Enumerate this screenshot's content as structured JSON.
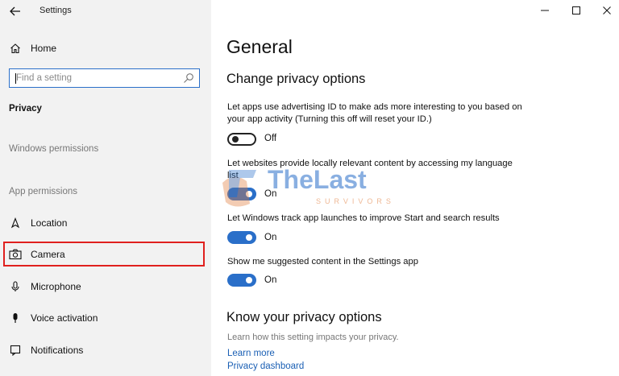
{
  "window": {
    "title": "Settings",
    "controls": {
      "minimize": "minimize",
      "maximize": "maximize",
      "close": "close"
    }
  },
  "sidebar": {
    "home_label": "Home",
    "search_placeholder": "Find a setting",
    "section_title": "Privacy",
    "group_windows": "Windows permissions",
    "group_app": "App permissions",
    "items": [
      {
        "label": "Location",
        "icon": "location-icon"
      },
      {
        "label": "Camera",
        "icon": "camera-icon",
        "highlighted": true
      },
      {
        "label": "Microphone",
        "icon": "microphone-icon"
      },
      {
        "label": "Voice activation",
        "icon": "voice-activation-icon"
      },
      {
        "label": "Notifications",
        "icon": "notifications-icon"
      }
    ],
    "highlight_color": "#e0201e"
  },
  "main": {
    "page_title": "General",
    "section_heading": "Change privacy options",
    "options": [
      {
        "text": "Let apps use advertising ID to make ads more interesting to you based on your app activity (Turning this off will reset your ID.)",
        "state": "Off",
        "on": false
      },
      {
        "text": "Let websites provide locally relevant content by accessing my language list",
        "state": "On",
        "on": true
      },
      {
        "text": "Let Windows track app launches to improve Start and search results",
        "state": "On",
        "on": true
      },
      {
        "text": "Show me suggested content in the Settings app",
        "state": "On",
        "on": true
      }
    ],
    "know_heading": "Know your privacy options",
    "know_desc": "Learn how this setting impacts your privacy.",
    "links": [
      "Learn more",
      "Privacy dashboard"
    ],
    "accent_color": "#2a6fc9"
  },
  "watermark": {
    "title": "TheLast",
    "subtitle": "SURVIVORS"
  }
}
